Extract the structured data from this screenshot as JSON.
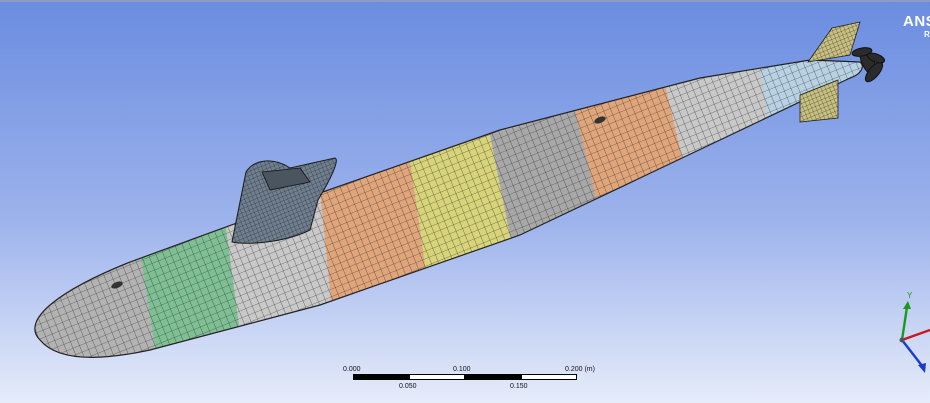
{
  "viewer": {
    "logo": "ANSYS",
    "logo_sub": "R"
  },
  "scale_bar": {
    "top_labels": [
      "0.000",
      "0.100",
      "0.200 (m)"
    ],
    "bottom_labels": [
      "0.050",
      "0.150"
    ]
  },
  "triad": {
    "y_label": "Y",
    "colors": {
      "x": "#c81818",
      "y": "#1a9a1a",
      "z": "#1a3ad0"
    }
  },
  "mesh_colors": {
    "grey": "#b3b3b3",
    "green": "#7fbf94",
    "light_grey": "#c9c9c9",
    "orange": "#e0a57a",
    "yellow": "#d8d47a",
    "mid_grey": "#a8a8a8",
    "light_blue": "#b8d2e4"
  }
}
